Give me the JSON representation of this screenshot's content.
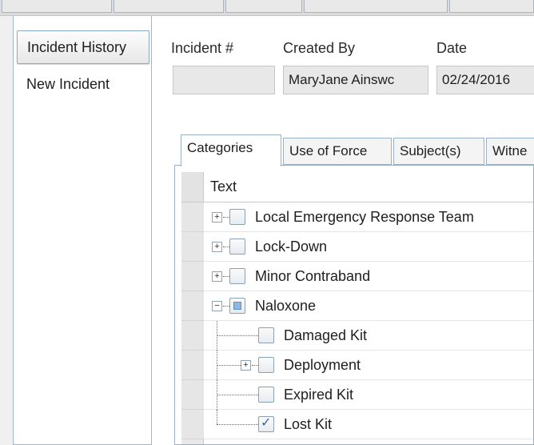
{
  "left_tabs": [
    {
      "label": "Incident History"
    },
    {
      "label": "New Incident"
    }
  ],
  "form": {
    "incident_label": "Incident #",
    "incident_value": "",
    "created_by_label": "Created By",
    "created_by_value": "MaryJane  Ainswc",
    "date_label": "Date",
    "date_value": "02/24/2016"
  },
  "inner_tabs": [
    "Categories",
    "Use of Force",
    "Subject(s)",
    "Witne"
  ],
  "grid": {
    "header": "Text",
    "rows": [
      {
        "label": "Local Emergency Response Team",
        "level": 0,
        "expander": "+",
        "checked": "none"
      },
      {
        "label": "Lock-Down",
        "level": 0,
        "expander": "+",
        "checked": "none"
      },
      {
        "label": "Minor Contraband",
        "level": 0,
        "expander": "+",
        "checked": "none"
      },
      {
        "label": "Naloxone",
        "level": 0,
        "expander": "-",
        "checked": "partial"
      },
      {
        "label": "Damaged Kit",
        "level": 1,
        "expander": "",
        "checked": "none"
      },
      {
        "label": "Deployment",
        "level": 1,
        "expander": "+",
        "checked": "none"
      },
      {
        "label": "Expired Kit",
        "level": 1,
        "expander": "",
        "checked": "none"
      },
      {
        "label": "Lost Kit",
        "level": 1,
        "expander": "",
        "checked": "checked"
      }
    ]
  }
}
